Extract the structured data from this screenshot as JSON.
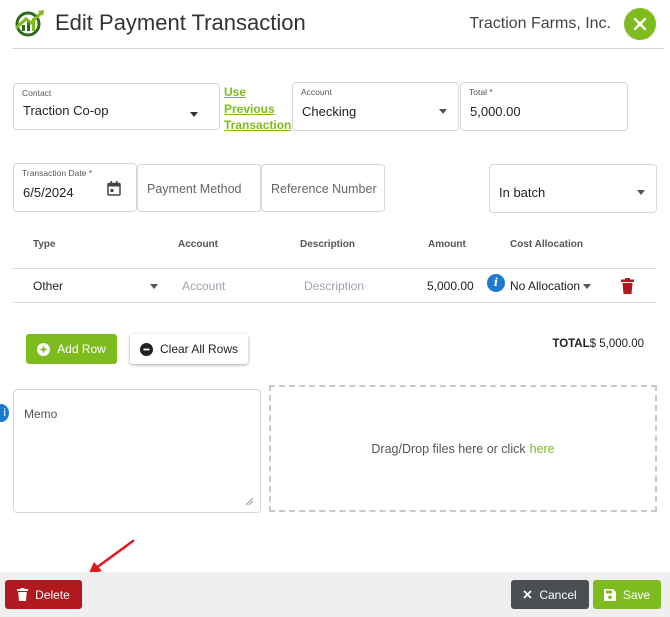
{
  "header": {
    "title": "Edit Payment Transaction",
    "company": "Traction Farms, Inc.",
    "logo_icon": "traction-logo-icon",
    "close_icon": "close-icon"
  },
  "contact": {
    "label": "Contact",
    "value": "Traction Co-op"
  },
  "previous_link": {
    "line1": "Use",
    "line2": "Previous",
    "line3": "Transaction"
  },
  "account": {
    "label": "Account",
    "value": "Checking"
  },
  "total_field": {
    "label": "Total *",
    "value": "5,000.00"
  },
  "transaction_date": {
    "label": "Transaction Date *",
    "value": "6/5/2024",
    "icon": "calendar-icon"
  },
  "payment_method": {
    "placeholder": "Payment Method"
  },
  "reference_number": {
    "placeholder": "Reference Number"
  },
  "batch": {
    "value": "In batch"
  },
  "table": {
    "headers": [
      "Type",
      "Account",
      "Description",
      "Amount",
      "Cost Allocation"
    ],
    "rows": [
      {
        "type": "Other",
        "account_placeholder": "Account",
        "description_placeholder": "Description",
        "amount": "5,000.00",
        "cost_allocation": "No Allocation"
      }
    ]
  },
  "buttons": {
    "add_row": "Add Row",
    "clear_all_rows": "Clear All Rows",
    "delete": "Delete",
    "cancel": "Cancel",
    "save": "Save"
  },
  "totals": {
    "label": "TOTAL",
    "value": "$ 5,000.00"
  },
  "memo": {
    "placeholder": "Memo"
  },
  "dropzone": {
    "text": "Drag/Drop files here or click",
    "link": "here"
  },
  "colors": {
    "brand_green": "#7dbb1e",
    "delete_red": "#b2191f",
    "info_blue": "#1e7ad0",
    "cancel_dark": "#4b4f53"
  }
}
